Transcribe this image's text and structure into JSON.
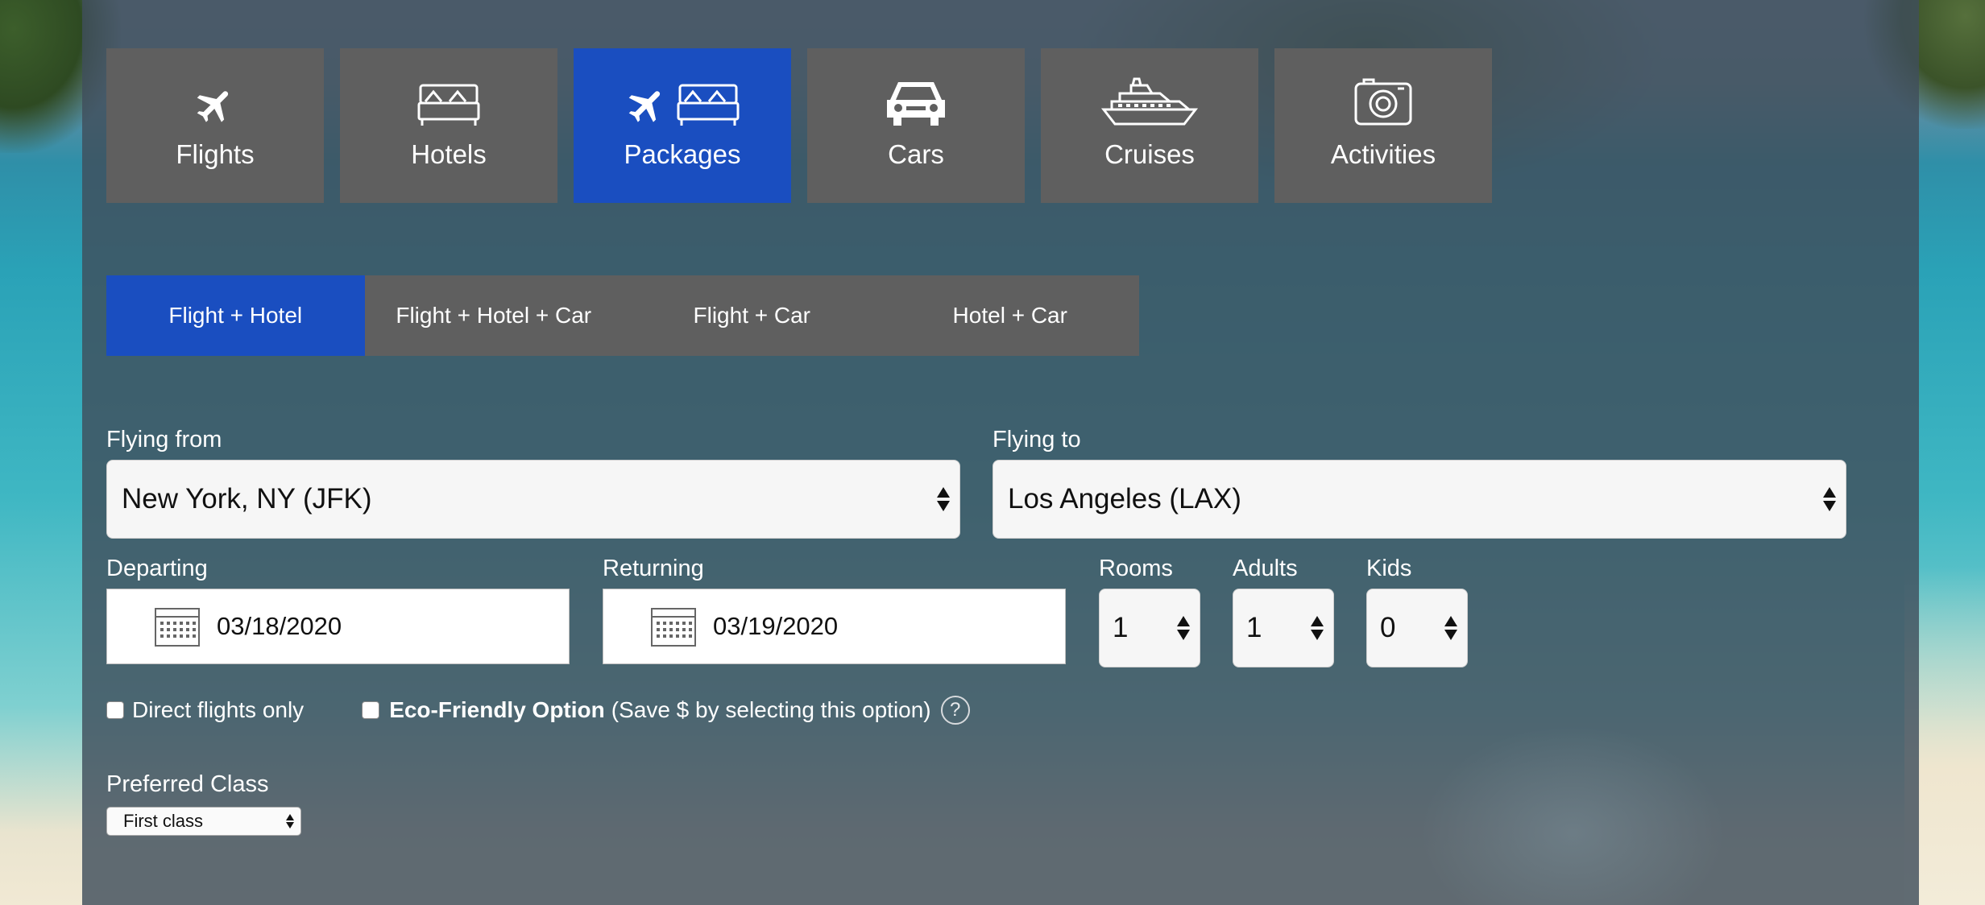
{
  "categories": [
    {
      "label": "Flights",
      "icon": "plane-icon",
      "active": false
    },
    {
      "label": "Hotels",
      "icon": "bed-icon",
      "active": false
    },
    {
      "label": "Packages",
      "icon": "plane-bed-icon",
      "active": true
    },
    {
      "label": "Cars",
      "icon": "car-icon",
      "active": false
    },
    {
      "label": "Cruises",
      "icon": "ship-icon",
      "active": false
    },
    {
      "label": "Activities",
      "icon": "camera-icon",
      "active": false
    }
  ],
  "package_tabs": [
    {
      "label": "Flight + Hotel",
      "active": true
    },
    {
      "label": "Flight + Hotel + Car",
      "active": false
    },
    {
      "label": "Flight + Car",
      "active": false
    },
    {
      "label": "Hotel + Car",
      "active": false
    }
  ],
  "form": {
    "flying_from_label": "Flying from",
    "flying_from_value": "New York, NY (JFK)",
    "flying_to_label": "Flying to",
    "flying_to_value": "Los Angeles (LAX)",
    "departing_label": "Departing",
    "departing_value": "03/18/2020",
    "returning_label": "Returning",
    "returning_value": "03/19/2020",
    "rooms_label": "Rooms",
    "rooms_value": "1",
    "adults_label": "Adults",
    "adults_value": "1",
    "kids_label": "Kids",
    "kids_value": "0",
    "direct_flights_label": "Direct flights only",
    "eco_bold": "Eco-Friendly Option",
    "eco_note": "(Save $ by selecting this option)",
    "help_glyph": "?",
    "preferred_class_label": "Preferred Class",
    "preferred_class_value": "First class"
  },
  "colors": {
    "accent": "#1a4ec0",
    "tile_bg": "#5f5f5f",
    "overlay": "#404e5c"
  }
}
